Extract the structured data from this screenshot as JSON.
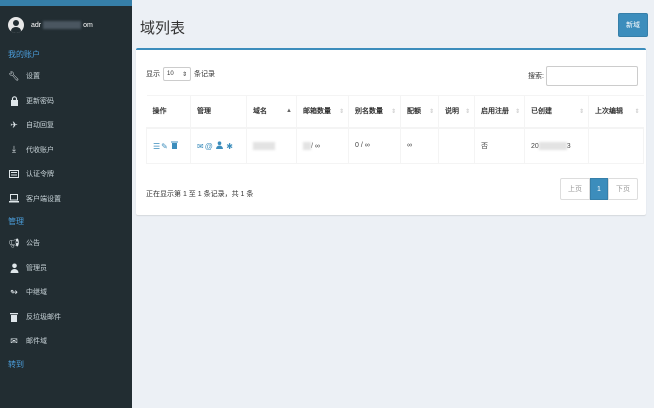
{
  "sidebar": {
    "user": {
      "prefix": "adr",
      "suffix": "om"
    },
    "sections": [
      {
        "header": "我的账户",
        "items": [
          {
            "label": "设置",
            "icon": "wrench-icon"
          },
          {
            "label": "更新密码",
            "icon": "lock-icon"
          },
          {
            "label": "自动回复",
            "icon": "plane-icon"
          },
          {
            "label": "代收账户",
            "icon": "download-icon"
          },
          {
            "label": "认证令牌",
            "icon": "id-card-icon"
          },
          {
            "label": "客户端设置",
            "icon": "laptop-icon"
          }
        ]
      },
      {
        "header": "管理",
        "items": [
          {
            "label": "公告",
            "icon": "bullhorn-icon"
          },
          {
            "label": "管理员",
            "icon": "user-icon"
          },
          {
            "label": "中继域",
            "icon": "share-icon"
          },
          {
            "label": "反垃圾邮件",
            "icon": "trash-icon"
          },
          {
            "label": "邮件域",
            "icon": "envelope-icon"
          }
        ]
      },
      {
        "header": "转到",
        "items": []
      }
    ]
  },
  "header": {
    "title": "域列表",
    "new_button": "新域"
  },
  "table_controls": {
    "show_label": "显示",
    "page_size": "10",
    "records_label": "条记录",
    "search_label": "搜索:"
  },
  "table": {
    "columns": [
      "操作",
      "管理",
      "域名",
      "邮箱数量",
      "别名数量",
      "配额",
      "说明",
      "启用注册",
      "已创建",
      "上次编辑"
    ],
    "row": {
      "mailboxes": "/ ∞",
      "aliases": "0 / ∞",
      "quota": "∞",
      "description": "",
      "registration": "否",
      "created_prefix": "20",
      "created_suffix": "3",
      "last_edit": ""
    }
  },
  "footer": {
    "info": "正在显示第 1 至 1 条记录，共 1 条",
    "prev": "上页",
    "current": "1",
    "next": "下页"
  }
}
